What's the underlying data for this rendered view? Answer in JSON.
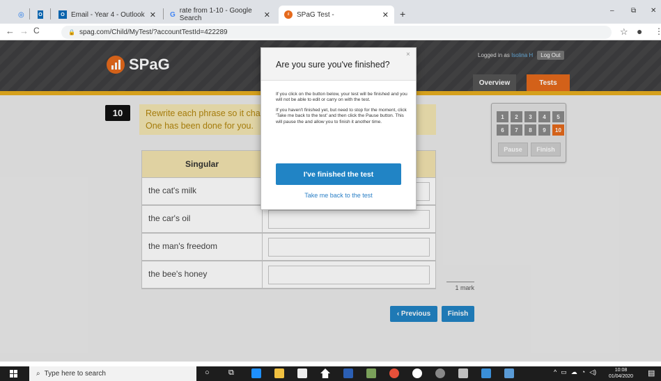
{
  "browser": {
    "tabs": [
      {
        "label": ""
      },
      {
        "label": ""
      },
      {
        "label": "Email - Year 4 - Outlook"
      },
      {
        "label": "rate from 1-10 - Google Search"
      },
      {
        "label": "SPaG Test -"
      }
    ],
    "new_tab": "+",
    "url": "spag.com/Child/MyTest/?accountTestId=422289",
    "window_controls": [
      "–",
      "⧉",
      "✕"
    ]
  },
  "header": {
    "logo": "SPaG",
    "logged_in_prefix": "Logged in as",
    "user": "Isolina H",
    "logout": "Log Out",
    "tabs": [
      {
        "label": "Overview"
      },
      {
        "label": "Tests"
      }
    ]
  },
  "question": {
    "number": "10",
    "line1": "Rewrite each phrase so it cha",
    "line2": "One has been done for you.",
    "column1": "Singular",
    "rows": [
      "the cat's milk",
      "the car's oil",
      "the man's freedom",
      "the bee's honey"
    ],
    "mark": "1 mark"
  },
  "nav": {
    "previous": "‹ Previous",
    "finish": "Finish"
  },
  "question_panel": {
    "numbers": [
      "1",
      "2",
      "3",
      "4",
      "5",
      "6",
      "7",
      "8",
      "9",
      "10"
    ],
    "current": "10",
    "pause": "Pause",
    "finish": "Finish"
  },
  "modal": {
    "title": "Are you sure you've finished?",
    "close": "×",
    "p1": "If you click on the button below, your test will be finished and you will not be able to edit or carry on with the test.",
    "p2": "If you haven't finished yet, but need to stop for the moment, click 'Take me back to the test' and then click the Pause button. This will pause the and allow you to finish it another time.",
    "confirm": "I've finished the test",
    "back": "Take me back to the test"
  },
  "taskbar": {
    "search_placeholder": "Type here to search",
    "time": "10:08",
    "date": "01/04/2020"
  },
  "colors": {
    "accent": "#2184c5",
    "brand": "#e56a1c",
    "header_bar": "#e8ae1f"
  }
}
